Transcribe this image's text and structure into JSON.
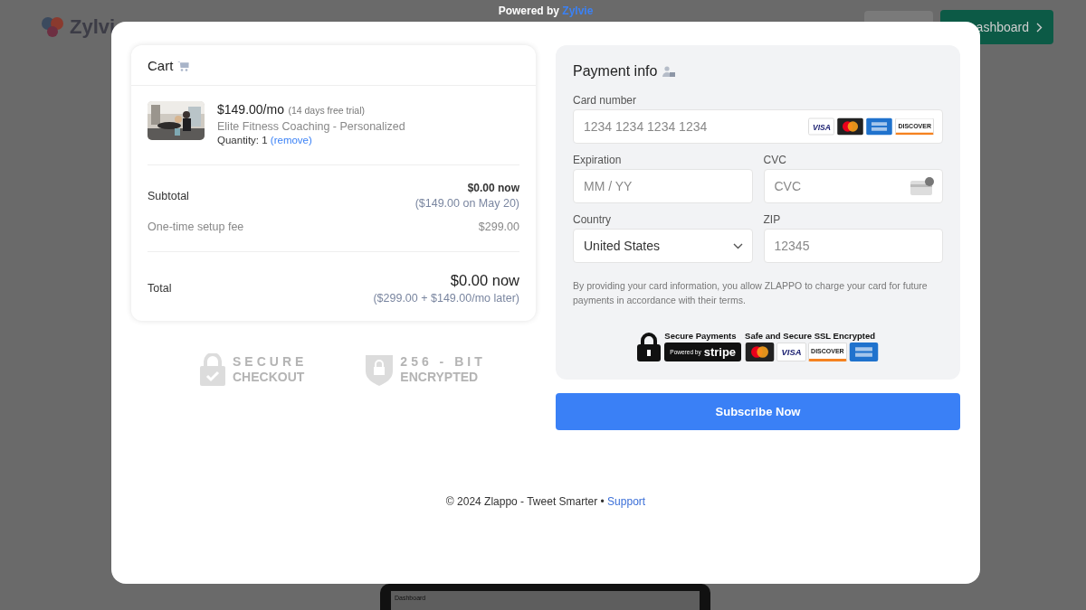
{
  "background": {
    "logo": "Zylvi",
    "dashboard_button": "ashboard",
    "laptop_title": "Dashboard"
  },
  "powered_by": {
    "label": "Powered by",
    "link": "Zylvie"
  },
  "cart": {
    "title": "Cart",
    "item": {
      "price": "$149.00/mo",
      "trial": "(14 days free trial)",
      "name": "Elite Fitness Coaching - Personalized",
      "quantity_label": "Quantity:",
      "quantity": "1",
      "remove": "(remove)"
    },
    "subtotal": {
      "label": "Subtotal",
      "now": "$0.00 now",
      "later": "($149.00 on May 20)"
    },
    "setup_fee": {
      "label": "One-time setup fee",
      "value": "$299.00"
    },
    "total": {
      "label": "Total",
      "now": "$0.00 now",
      "later": "($299.00 + $149.00/mo later)"
    }
  },
  "trust_badges": [
    {
      "kind": "lock",
      "line1": "SECURE",
      "line2": "CHECKOUT"
    },
    {
      "kind": "shield",
      "line1": "256 - BIT",
      "line2": "ENCRYPTED"
    }
  ],
  "payment": {
    "title": "Payment info",
    "fields": [
      {
        "kind": "card",
        "label": "Card number",
        "placeholder": "1234 1234 1234 1234"
      },
      {
        "kind": "text",
        "label": "Expiration",
        "placeholder": "MM / YY"
      },
      {
        "kind": "cvc",
        "label": "CVC",
        "placeholder": "CVC"
      },
      {
        "kind": "select",
        "label": "Country",
        "value": "United States"
      },
      {
        "kind": "text",
        "label": "ZIP",
        "placeholder": "12345"
      }
    ],
    "card_brands": [
      {
        "kind": "visa",
        "label": "VISA"
      },
      {
        "kind": "mastercard"
      },
      {
        "kind": "amex"
      },
      {
        "kind": "discover",
        "label": "DISCOVER"
      }
    ],
    "notice": "By providing your card information, you allow ZLAPPO to charge your card for future payments in accordance with their terms.",
    "secure_badge": {
      "title_left": "Secure Payments",
      "title_right": "Safe and Secure SSL Encrypted",
      "stripe_prefix": "Powered by",
      "stripe": "stripe",
      "brands": [
        {
          "kind": "mastercard"
        },
        {
          "kind": "visa",
          "label": "VISA"
        },
        {
          "kind": "discover",
          "label": "DISCOVER"
        },
        {
          "kind": "amex"
        }
      ]
    }
  },
  "subscribe_button": "Subscribe Now",
  "footer": {
    "text": "© 2024 Zlappo - Tweet Smarter •",
    "link": "Support"
  }
}
